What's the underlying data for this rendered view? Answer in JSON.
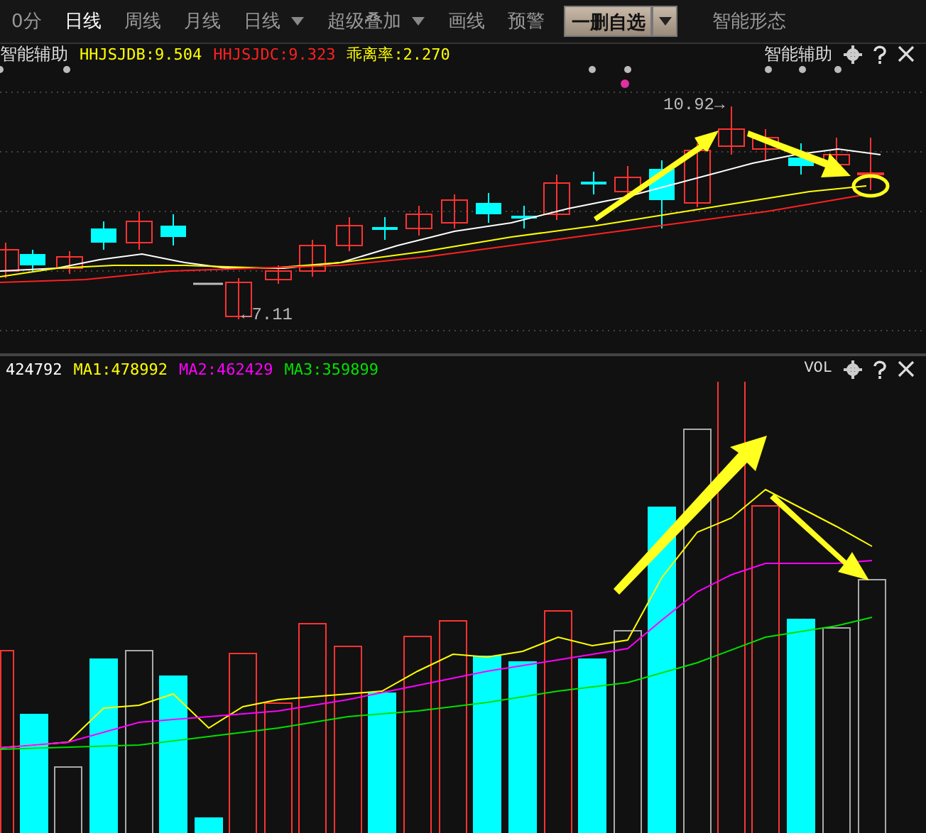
{
  "toolbar": [
    {
      "label": "0分",
      "kind": "tab",
      "selected": false
    },
    {
      "label": "日线",
      "kind": "tab",
      "selected": true
    },
    {
      "label": "周线",
      "kind": "tab",
      "selected": false
    },
    {
      "label": "月线",
      "kind": "tab",
      "selected": false
    },
    {
      "label": "日线",
      "kind": "dropdown"
    },
    {
      "label": "超级叠加",
      "kind": "dropdown"
    },
    {
      "label": "画线",
      "kind": "tab",
      "selected": false
    },
    {
      "label": "预警",
      "kind": "tab",
      "selected": false
    },
    {
      "label": "一删自选",
      "kind": "button"
    },
    {
      "label": "智能形态",
      "kind": "tab",
      "selected": false
    }
  ],
  "price_panel": {
    "title": "智能辅助",
    "indicators": [
      {
        "text": "HHJSJDB:9.504",
        "color": "#ffff00"
      },
      {
        "text": "HHJSJDC:9.323",
        "color": "#ff2020"
      },
      {
        "text": "乖离率:2.270",
        "color": "#ffff00"
      }
    ],
    "right_label": "智能辅助",
    "high_label": "10.92→",
    "low_label": "←7.11"
  },
  "volume_panel": {
    "indicators": [
      {
        "text": "424792",
        "color": "#ffffff"
      },
      {
        "text": "MA1:478992",
        "color": "#ffff00"
      },
      {
        "text": "MA2:462429",
        "color": "#ff00ff"
      },
      {
        "text": "MA3:359899",
        "color": "#00e000"
      }
    ],
    "right_label": "VOL"
  }
}
